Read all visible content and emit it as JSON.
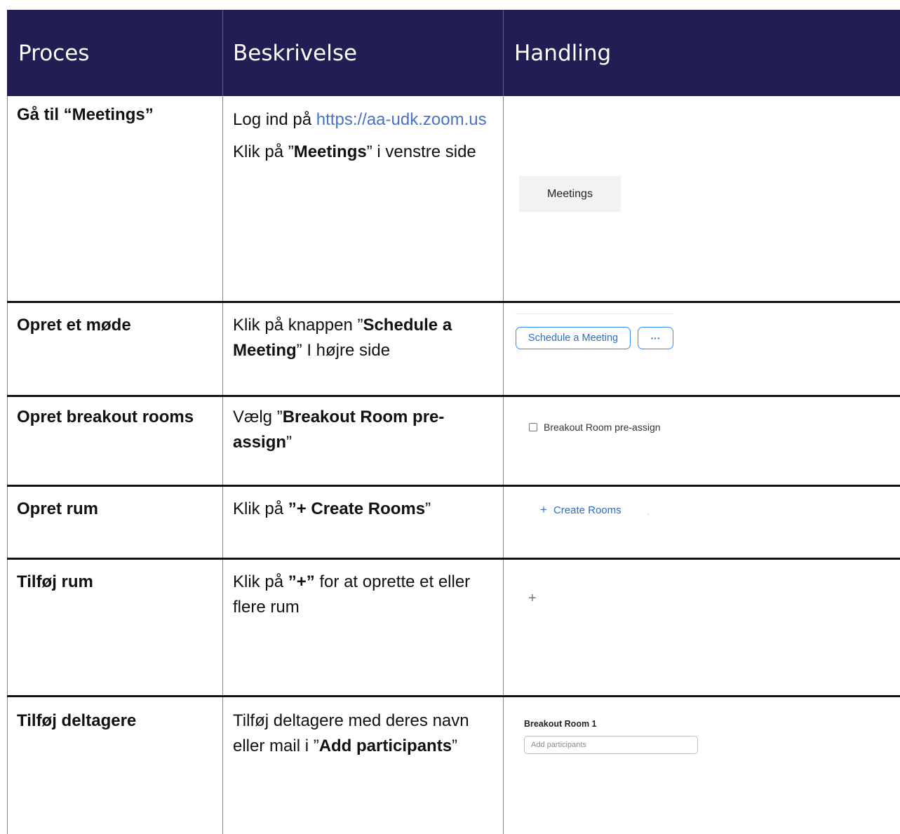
{
  "header": {
    "col1": "Proces",
    "col2": "Beskrivelse",
    "col3": "Handling"
  },
  "rows": [
    {
      "process": "Gå til “Meetings”",
      "desc_line1_prefix": "Log ind på ",
      "desc_link": "https://aa-udk.zoom.us",
      "desc_p2_prefix": "Klik på ”",
      "desc_p2_bold": "Meetings",
      "desc_p2_suffix": "” i venstre side",
      "ui": {
        "nav_label": "Meetings"
      }
    },
    {
      "process": "Opret et møde",
      "desc_prefix": "Klik på knappen ”",
      "desc_bold": "Schedule a Meeting",
      "desc_suffix": "” I højre side",
      "ui": {
        "schedule_button": "Schedule a Meeting",
        "more_button": "···"
      }
    },
    {
      "process": "Opret breakout rooms",
      "desc_prefix": "Vælg ”",
      "desc_bold": "Breakout Room pre-assign",
      "desc_suffix": "”",
      "ui": {
        "checkbox_label": "Breakout Room pre-assign",
        "checked": false
      }
    },
    {
      "process": "Opret rum",
      "desc_prefix": "Klik på ",
      "desc_bold": "”+ Create Rooms",
      "desc_suffix": "”",
      "ui": {
        "create_rooms_icon": "+",
        "create_rooms_label": "Create Rooms"
      }
    },
    {
      "process": "Tilføj rum",
      "desc_prefix": "Klik på ",
      "desc_bold": "”+”",
      "desc_suffix": " for at oprette et eller flere rum",
      "ui": {
        "plus_icon": "+"
      }
    },
    {
      "process": "Tilføj deltagere",
      "desc_prefix": "Tilføj deltagere med deres navn eller mail i ”",
      "desc_bold": "Add participants",
      "desc_suffix": "”",
      "ui": {
        "room_title": "Breakout Room 1",
        "input_placeholder": "Add participants"
      }
    }
  ]
}
